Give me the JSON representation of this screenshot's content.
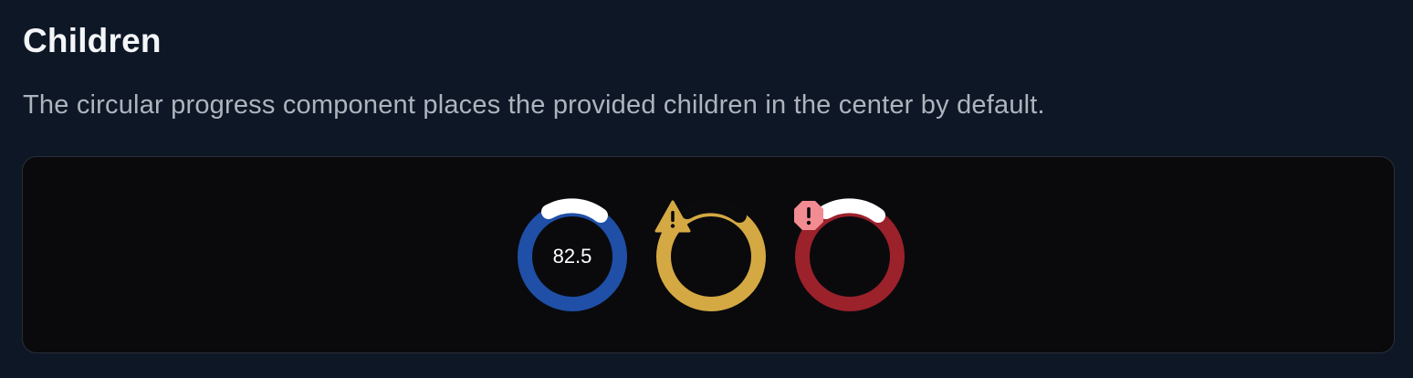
{
  "section": {
    "title": "Children",
    "description": "The circular progress component places the provided children in the center by default."
  },
  "demo": {
    "items": [
      {
        "kind": "value",
        "label": "82.5",
        "progress": 0.825,
        "color": "#1f4fa6",
        "indicator_color": "#ffffff",
        "icon": null
      },
      {
        "kind": "icon",
        "label": "",
        "progress": 0.825,
        "color": "#d4a943",
        "indicator_color": "#0b0b0d",
        "icon": "warning-triangle-icon"
      },
      {
        "kind": "icon",
        "label": "",
        "progress": 0.825,
        "color": "#9b212b",
        "indicator_color": "#ffffff",
        "icon": "error-octagon-icon"
      }
    ]
  }
}
